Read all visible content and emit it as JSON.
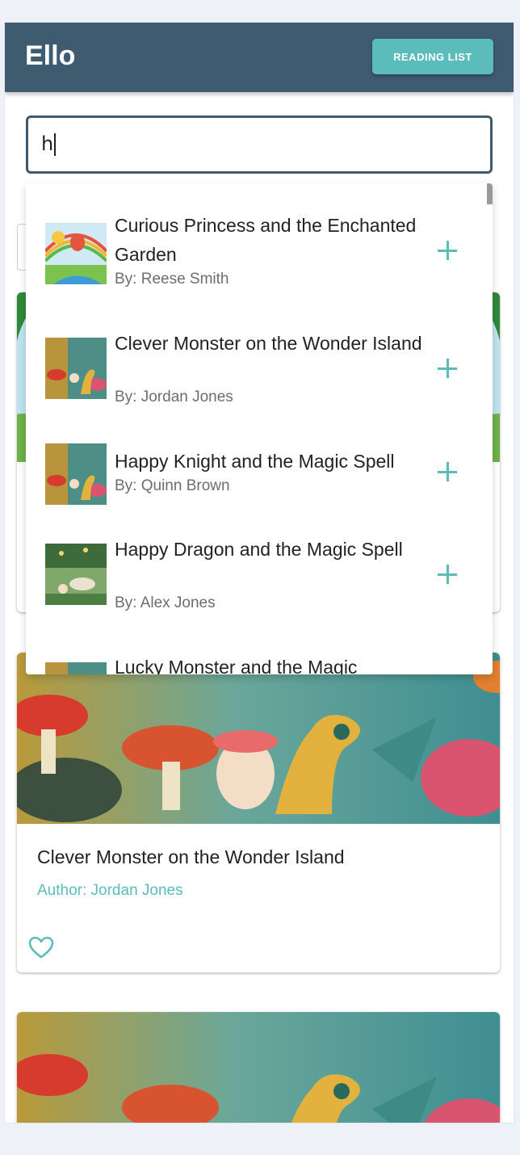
{
  "app": {
    "title": "Ello",
    "reading_list_label": "READING LIST"
  },
  "search": {
    "value": "h"
  },
  "results": [
    {
      "title": "Curious Princess and the Enchanted Garden",
      "author": "By: Reese Smith"
    },
    {
      "title": "Clever Monster on the Wonder Island",
      "author": "By: Jordan Jones"
    },
    {
      "title": "Happy Knight and the Magic Spell",
      "author": "By: Quinn Brown"
    },
    {
      "title": "Happy Dragon and the Magic Spell",
      "author": "By: Alex Jones"
    },
    {
      "title": "Lucky Monster and the Magic",
      "author": ""
    }
  ],
  "cards": [
    {
      "title": "Clever Monster on the Wonder Island",
      "author": "Author: Jordan Jones"
    }
  ],
  "colors": {
    "header": "#3e5b70",
    "accent": "#5cbcbb",
    "background": "#eef1f8"
  },
  "icons": {
    "add": "plus-icon",
    "favorite": "heart-outline-icon"
  }
}
